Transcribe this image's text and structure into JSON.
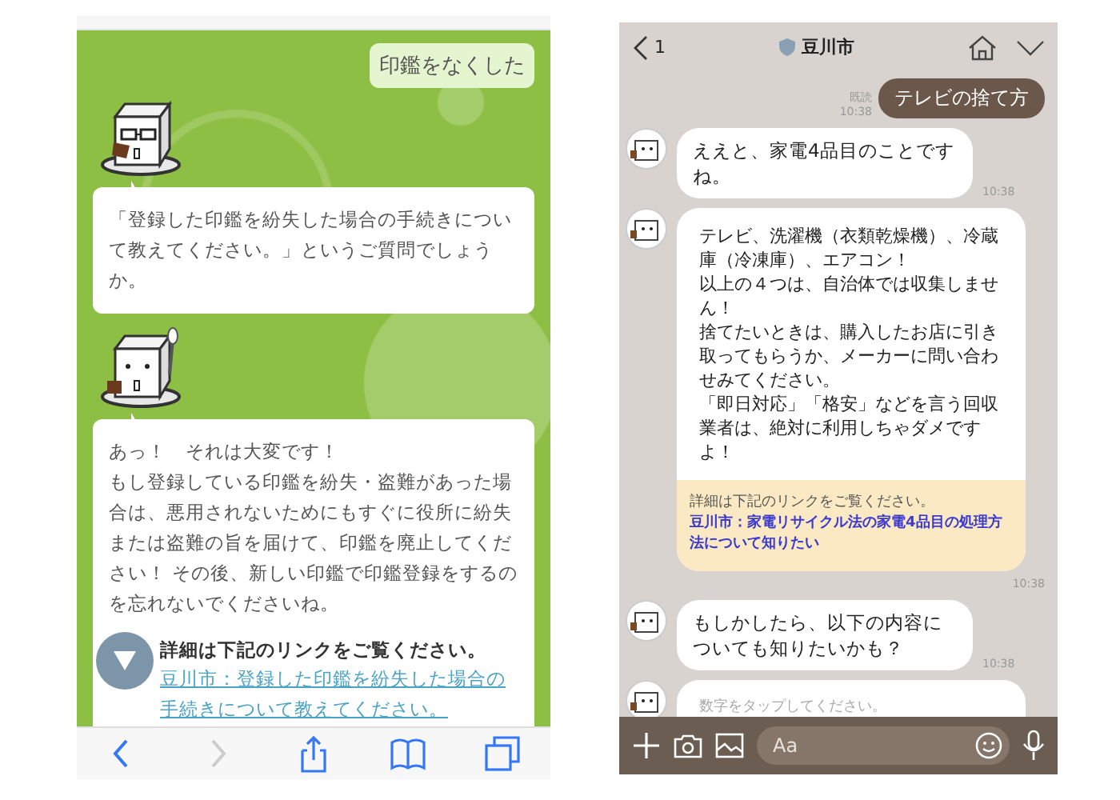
{
  "left_screen": {
    "messages": [
      {
        "kind": "user",
        "text": "印鑑をなくした"
      },
      {
        "kind": "bot",
        "paragraphs": [
          "「登録した印鑑を紛失した場合の手続きについて教えてください。」というご質問でしょうか。"
        ]
      },
      {
        "kind": "bot",
        "paragraphs": [
          "あっ！　それは大変です！",
          "もし登録している印鑑を紛失・盗難があった場合は、悪用されないためにもすぐに役所に紛失または盗難の旨を届けて、印鑑を廃止してください！ その後、新しい印鑑で印鑑登録をするのを忘れないでくださいね。"
        ],
        "detail": "詳細は下記のリンクをご覧ください。",
        "link": "豆川市：登録した印鑑を紛失した場合の手続きについて教えてください。"
      }
    ],
    "toolbar": [
      {
        "kind": "back",
        "disabled": false
      },
      {
        "kind": "forward",
        "disabled": true
      },
      {
        "kind": "share",
        "disabled": false
      },
      {
        "kind": "bookmarks",
        "disabled": false
      },
      {
        "kind": "tabs",
        "disabled": false
      }
    ]
  },
  "right_screen": {
    "header": {
      "back": "1",
      "title": "豆川市"
    },
    "messages": [
      {
        "kind": "user",
        "text": "テレビの捨て方",
        "read": "既読",
        "time": "10:38"
      },
      {
        "kind": "bot",
        "text": "ええと、家電4品目のことですね。",
        "time": "10:38"
      },
      {
        "kind": "bot",
        "paragraphs": [
          "テレビ、洗濯機（衣類乾燥機）、冷蔵庫（冷凍庫）、エアコン！",
          "以上の４つは、自治体では収集しません！",
          "捨てたいときは、購入したお店に引き取ってもらうか、メーカーに問い合わせみてください。",
          "「即日対応」「格安」などを言う回収業者は、絶対に利用しちゃダメですよ！"
        ],
        "detail": "詳細は下記のリンクをご覧ください。",
        "link": "豆川市：家電リサイクル法の家電4品目の処理方法について知りたい",
        "time": "10:38"
      },
      {
        "kind": "bot",
        "text": "もしかしたら、以下の内容についても知りたいかも？",
        "time": "10:38"
      },
      {
        "kind": "hint",
        "text": "数字をタップしてください。"
      }
    ],
    "input": {
      "placeholder": "Aa"
    }
  }
}
